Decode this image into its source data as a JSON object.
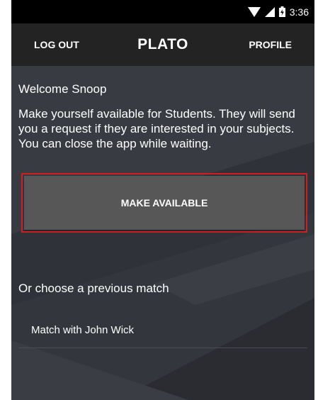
{
  "status_bar": {
    "time": "3:36",
    "icons": [
      "wifi-icon",
      "signal-icon",
      "battery-icon"
    ]
  },
  "app_bar": {
    "logout_label": "LOG OUT",
    "title": "PLATO",
    "profile_label": "PROFILE"
  },
  "main": {
    "welcome": "Welcome Snoop",
    "description": "Make yourself available for Students. They will send you a request if they are interested in your subjects. You can close the app while waiting.",
    "make_available_label": "MAKE AVAILABLE",
    "previous_matches_heading": "Or choose a previous match",
    "matches": [
      {
        "label": "Match with John Wick"
      }
    ]
  },
  "colors": {
    "status_bar": "#000000",
    "app_bar": "#232323",
    "background": "#33363d",
    "button": "#575757",
    "highlight_border": "#d11f1f"
  }
}
